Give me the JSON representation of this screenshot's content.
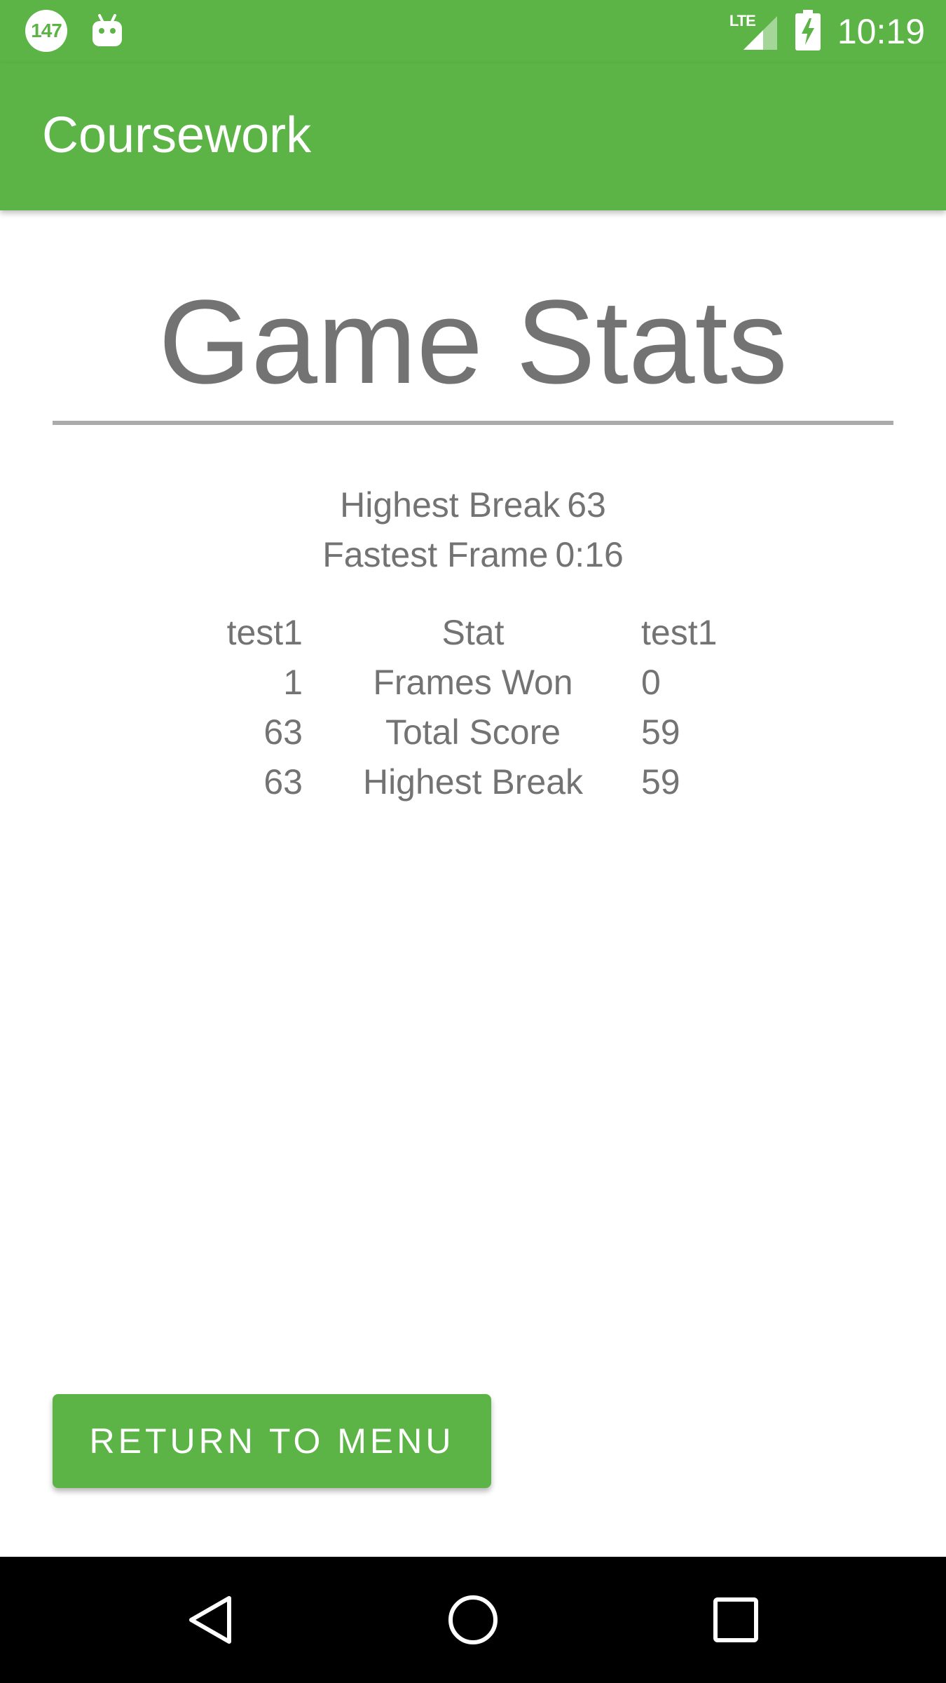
{
  "status_bar": {
    "notification_badge": "147",
    "network_type": "LTE",
    "time": "10:19",
    "icons": [
      "notification-badge-icon",
      "android-debug-icon",
      "lte-signal-icon",
      "battery-charging-icon"
    ]
  },
  "app_bar": {
    "title": "Coursework"
  },
  "main": {
    "heading": "Game Stats",
    "summary": [
      {
        "label": "Highest Break",
        "value": "63"
      },
      {
        "label": "Fastest Frame",
        "value": "0:16"
      }
    ],
    "table": {
      "header": {
        "left": "test1",
        "mid": "Stat",
        "right": "test1"
      },
      "rows": [
        {
          "left": "1",
          "mid": "Frames Won",
          "right": "0"
        },
        {
          "left": "63",
          "mid": "Total Score",
          "right": "59"
        },
        {
          "left": "63",
          "mid": "Highest Break",
          "right": "59"
        }
      ]
    },
    "return_button_label": "RETURN TO MENU"
  },
  "nav_bar": {
    "icons": [
      "back-icon",
      "home-icon",
      "recents-icon"
    ]
  },
  "colors": {
    "accent": "#5cb446",
    "text_gray": "#737373",
    "rule": "#ababab"
  }
}
